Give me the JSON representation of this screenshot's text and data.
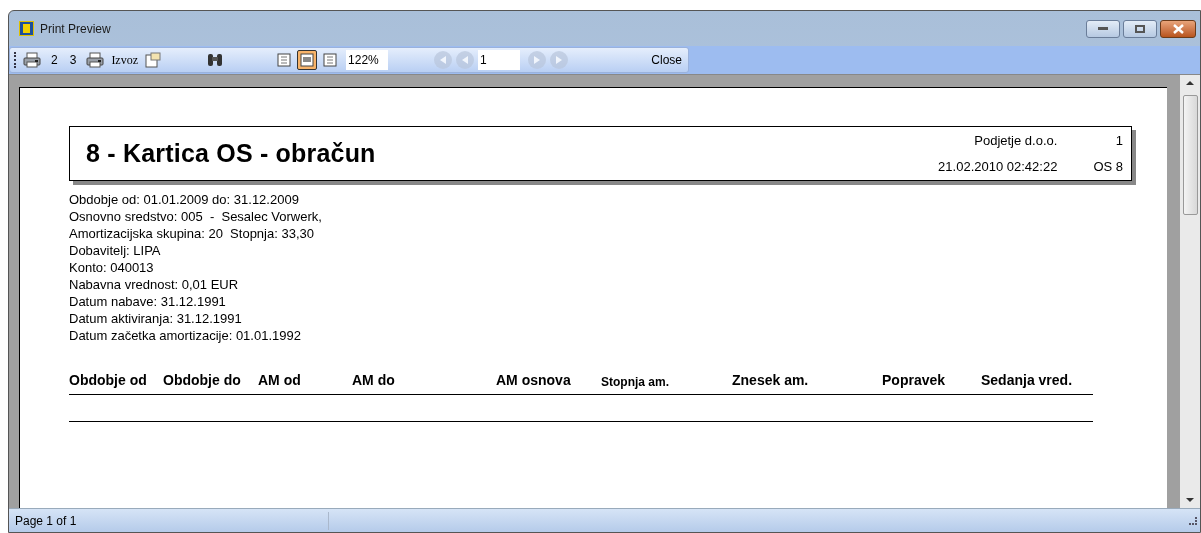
{
  "window": {
    "title": "Print Preview"
  },
  "toolbar": {
    "print_options": [
      "2",
      "3"
    ],
    "export_label": "Izvoz",
    "view_modes": [
      {
        "selected": false
      },
      {
        "selected": true
      },
      {
        "selected": false
      }
    ],
    "zoom": "122%",
    "back_buttons": [
      {
        "disabled": true
      },
      {
        "disabled": true
      }
    ],
    "page": "1",
    "forward_buttons": [
      {
        "disabled": true
      },
      {
        "disabled": true
      }
    ],
    "close": "Close"
  },
  "report": {
    "title": "8 - Kartica OS - obračun",
    "company": "Podjetje d.o.o.",
    "page_number": "1",
    "datetime": "21.02.2010 02:42:22",
    "code": "OS 8",
    "info": [
      "Obdobje od: 01.01.2009 do: 31.12.2009",
      "Osnovno sredstvo: 005  -  Sesalec Vorwerk,",
      "Amortizacijska skupina: 20  Stopnja: 33,30",
      "Dobavitelj: LIPA",
      "Konto: 040013",
      "Nabavna vrednost: 0,01 EUR",
      "Datum nabave: 31.12.1991",
      "Datum aktiviranja: 31.12.1991",
      "Datum začetka amortizacije: 01.01.1992"
    ],
    "columns": [
      "Obdobje od",
      "Obdobje do",
      "AM od",
      "AM do",
      "AM osnova",
      "Stopnja am.",
      "Znesek am.",
      "Popravek",
      "Sedanja vred."
    ]
  },
  "status_bar": {
    "text": "Page 1 of 1"
  }
}
